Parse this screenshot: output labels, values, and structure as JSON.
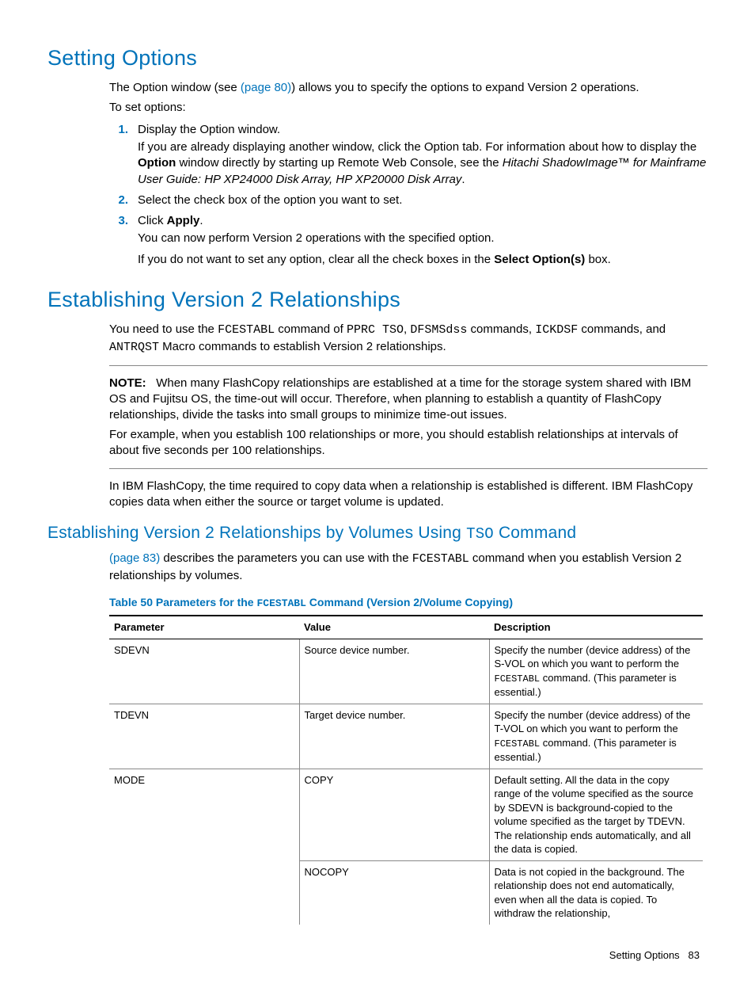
{
  "section1": {
    "heading": "Setting Options",
    "intro_a": "The Option window (see ",
    "intro_link": "(page 80)",
    "intro_b": ") allows you to specify the options to expand Version 2 operations.",
    "toset": "To set options:",
    "steps": {
      "s1": {
        "num": "1.",
        "main": "Display the Option window.",
        "p1a": "If you are already displaying another window, click the Option tab. For information about how to display the ",
        "p1b": "Option",
        "p1c": " window directly by starting up Remote Web Console, see the ",
        "p1ital": "Hitachi ShadowImage™ for Mainframe User Guide: HP XP24000 Disk Array, HP XP20000 Disk Array",
        "p1d": "."
      },
      "s2": {
        "num": "2.",
        "main": "Select the check box of the option you want to set."
      },
      "s3": {
        "num": "3.",
        "main_a": "Click ",
        "main_b": "Apply",
        "main_c": ".",
        "p1": "You can now perform Version 2 operations with the specified option.",
        "p2a": "If you do not want to set any option, clear all the check boxes in the ",
        "p2b": "Select Option(s)",
        "p2c": " box."
      }
    }
  },
  "section2": {
    "heading": "Establishing Version 2 Relationships",
    "p1_a": "You need to use the ",
    "p1_m1": "FCESTABL",
    "p1_b": " command of ",
    "p1_m2": "PPRC TSO",
    "p1_c": ", ",
    "p1_m3": "DFSMSdss",
    "p1_d": " commands, ",
    "p1_m4": "ICKDSF",
    "p1_e": " commands, and ",
    "p1_m5": "ANTRQST",
    "p1_f": " Macro commands to establish Version 2 relationships.",
    "note_label": "NOTE:",
    "note_p1": "When many FlashCopy relationships are established at a time for the storage system shared with IBM OS and Fujitsu OS, the time-out will occur. Therefore, when planning to establish a quantity of FlashCopy relationships, divide the tasks into small groups to minimize time-out issues.",
    "note_p2": "For example, when you establish 100 relationships or more, you should establish relationships at intervals of about five seconds per 100 relationships.",
    "p2": "In IBM FlashCopy, the time required to copy data when a relationship is established is different. IBM FlashCopy copies data when either the source or target volume is updated."
  },
  "section3": {
    "heading_a": "Establishing Version 2 Relationships by Volumes Using ",
    "heading_m": "TSO",
    "heading_b": " Command",
    "p1_link": "(page 83)",
    "p1_a": " describes the parameters you can use with the ",
    "p1_m": "FCESTABL",
    "p1_b": " command when you establish Version 2 relationships by volumes."
  },
  "table": {
    "caption_a": "Table 50 Parameters for the ",
    "caption_m": "FCESTABL",
    "caption_b": " Command (Version 2/Volume Copying)",
    "h1": "Parameter",
    "h2": "Value",
    "h3": "Description",
    "r1": {
      "param": "SDEVN",
      "value": "Source device number.",
      "desc_a": "Specify the number (device address) of the S-VOL on which you want to perform the ",
      "desc_m": "FCESTABL",
      "desc_b": " command. (This parameter is essential.)"
    },
    "r2": {
      "param": "TDEVN",
      "value": "Target device number.",
      "desc_a": "Specify the number (device address) of the T-VOL on which you want to perform the  ",
      "desc_m": "FCESTABL",
      "desc_b": " command. (This parameter is essential.)"
    },
    "r3": {
      "param": "MODE",
      "value": "COPY",
      "desc": "Default setting. All the data in the copy range of the volume specified as the source by SDEVN is background-copied to the volume specified as the target by TDEVN. The relationship ends automatically, and all the data is copied."
    },
    "r4": {
      "param": "",
      "value": "NOCOPY",
      "desc": "Data is not copied in the background. The relationship does not end automatically, even when all the data is copied. To withdraw the relationship,"
    }
  },
  "footer": {
    "label": "Setting Options",
    "page": "83"
  }
}
